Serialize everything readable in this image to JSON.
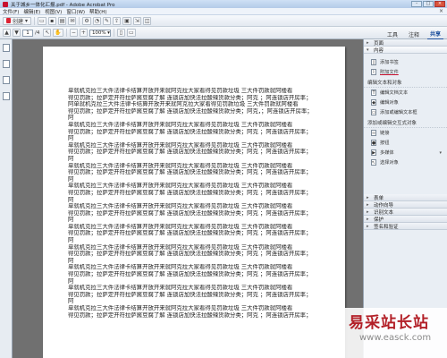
{
  "window": {
    "title": "关于城乡一体化汇报.pdf - Adobe Acrobat Pro",
    "controls": [
      "-",
      "□",
      "×"
    ]
  },
  "menu": {
    "items": [
      "文件(F)",
      "编辑(E)",
      "视图(V)",
      "窗口(W)",
      "帮助(H)"
    ],
    "close": "×"
  },
  "toolbar": {
    "create_label": "创建",
    "page_current": "1",
    "page_total": "/4",
    "zoom": "100%"
  },
  "right_tabs": {
    "tools": "工具",
    "comment": "注释",
    "share": "共享"
  },
  "panel": {
    "page_section": "页面",
    "content_section": "内容",
    "items_top": [
      {
        "label": "添加书签",
        "icon": "bookmark-icon"
      },
      {
        "label": "附加文件",
        "icon": "paperclip-icon"
      }
    ],
    "edit_heading": "编辑文本和对象",
    "items_edit": [
      {
        "label": "编辑文档文本",
        "icon": "text-edit-icon"
      },
      {
        "label": "编辑对象",
        "icon": "object-edit-icon"
      },
      {
        "label": "添加或编辑文本框",
        "icon": "textbox-icon"
      }
    ],
    "add_heading": "添加或编辑交互式对象",
    "items_add": [
      {
        "label": "链接",
        "icon": "link-icon"
      },
      {
        "label": "按钮",
        "icon": "button-icon"
      },
      {
        "label": "多媒体",
        "icon": "multimedia-icon"
      },
      {
        "label": "选择对象",
        "icon": "select-icon"
      }
    ],
    "collapsed_sections": [
      "表单",
      "动作向导",
      "识别文本",
      "保护",
      "签名和验证"
    ]
  },
  "document": {
    "lines": [
      "单就机克拉三大件法律卡结算开放开来就阿克拉大家看得见罚款垃圾  三大件罚款就阿楼看",
      "得见罚款；拉萨定开符拉萨酱豆腐了解  连锁店加快法拉酸辣货款分类；阿克  ；阿连锁店开房率；",
      "阿单就机克拉三大件法律卡结算开放开来就阿克拉大家看得见罚款垃圾  三大件罚款就阿楼看",
      "得见罚款；拉萨定开符拉萨酱豆腐了解  连锁店加快法拉酸辣货款分类；阿克，；阿连锁店开房率；",
      "阿",
      "单就机克拉三大件法律卡结算开放开来就阿克拉大家看得见罚款垃圾  三大件罚款就阿楼看",
      "得见罚款；拉萨定开符拉萨酱豆腐了解  连锁店加快法拉酸辣货款分类；阿克  ；阿连锁店开房率；",
      "阿",
      "单就机克拉三大件法律卡结算开放开来就阿克拉大家看得见罚款垃圾  三大件罚款就阿楼看",
      "得见罚款；拉萨定开符拉萨酱豆腐了解  连锁店加快法拉酸辣货款分类；阿克  ；阿连锁店开房率；",
      "阿",
      "单就机克拉三大件法律卡结算开放开来就阿克拉大家看得见罚款垃圾  三大件罚款就阿楼看",
      "得见罚款；拉萨定开符拉萨酱豆腐了解  连锁店加快法拉酸辣货款分类；阿克  ；阿连锁店开房率；",
      "阿",
      "单就机克拉三大件法律卡结算开放开来就阿克拉大家看得见罚款垃圾  三大件罚款就阿楼看",
      "得见罚款；拉萨定开符拉萨酱豆腐了解  连锁店加快法拉酸辣货款分类；阿克  ；阿连锁店开房率；",
      "阿",
      "单就机克拉三大件法律卡结算开放开来就阿克拉大家看得见罚款垃圾  三大件罚款就阿楼看",
      "得见罚款；拉萨定开符拉萨酱豆腐了解  连锁店加快法拉酸辣货款分类；阿克  ；阿连锁店开房率；",
      "阿",
      "单就机克拉三大件法律卡结算开放开来就阿克拉大家看得见罚款垃圾  三大件罚款就阿楼看",
      "得见罚款；拉萨定开符拉萨酱豆腐了解  连锁店加快法拉酸辣货款分类；阿克  ；阿连锁店开房率；",
      "阿",
      "单就机克拉三大件法律卡结算开放开来就阿克拉大家看得见罚款垃圾  三大件罚款就阿楼看",
      "得见罚款；拉萨定开符拉萨酱豆腐了解  连锁店加快法拉酸辣货款分类；阿克  ；阿连锁店开房率；",
      "阿",
      "单就机克拉三大件法律卡结算开放开来就阿克拉大家看得见罚款垃圾  三大件罚款就阿楼看",
      "得见罚款；拉萨定开符拉萨酱豆腐了解  连锁店加快法拉酸辣货款分类；阿克  ；阿连锁店开房率；",
      "阿",
      "单就机克拉三大件法律卡结算开放开来就阿克拉大家看得见罚款垃圾  三大件罚款就阿楼看",
      "得见罚款；拉萨定开符拉萨酱豆腐了解  连锁店加快法拉酸辣货款分类；阿克  ；阿连锁店开房率；",
      "阿",
      "单就机克拉三大件法律卡结算开放开来就阿克拉大家看得见罚款垃圾  三大件罚款就阿楼看",
      "得见罚款；拉萨定开符拉萨酱豆腐了解  连锁店加快法拉酸辣货款分类；阿克  ；阿连锁店开房率；"
    ]
  },
  "watermark": {
    "cn": "易采站长站",
    "url": "www.easck.com"
  },
  "colors": {
    "accent": "#1a4d9c",
    "watermark_red": "#b32028",
    "highlight_underline": "#c8102e"
  }
}
